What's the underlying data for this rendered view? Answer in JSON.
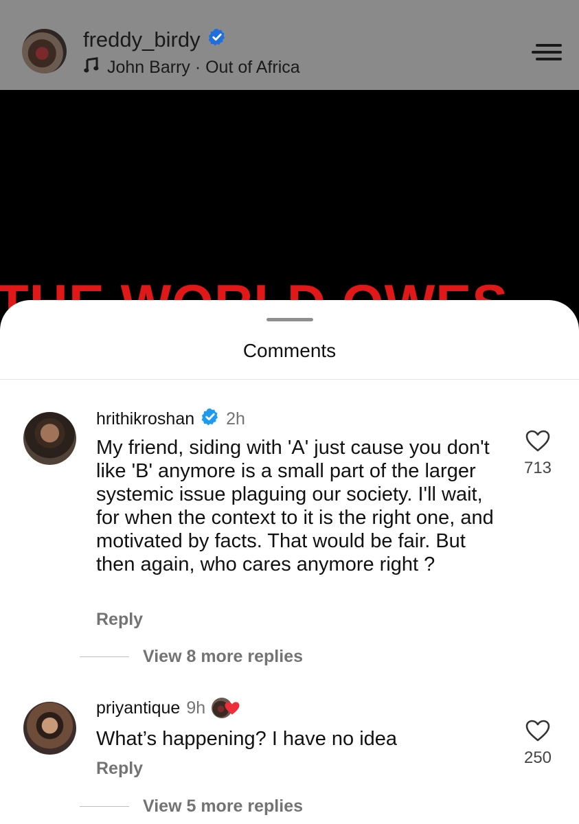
{
  "header": {
    "username": "freddy_birdy",
    "music": "John Barry · Out of Africa"
  },
  "video": {
    "overlay_text": "THE WORLD OWES"
  },
  "comments_sheet": {
    "title": "Comments",
    "comments": [
      {
        "username": "hrithikroshan",
        "time": "2h",
        "text": "My friend, siding with 'A' just cause you don't like 'B' anymore is a small part of the larger systemic issue plaguing our society.  I'll wait, for when the context to it is the right one, and motivated by facts. That would be fair. But then again, who cares anymore right ?",
        "likes": "713",
        "reply_label": "Reply",
        "view_replies": "View 8 more replies"
      },
      {
        "username": "priyantique",
        "time": "9h",
        "text": "What’s happening? I have no idea",
        "likes": "250",
        "reply_label": "Reply",
        "view_replies": "View 5 more replies"
      }
    ]
  },
  "colors": {
    "verified": "#1d9bf0",
    "video_text": "#e01818",
    "heart_badge": "#ed2f3a"
  }
}
